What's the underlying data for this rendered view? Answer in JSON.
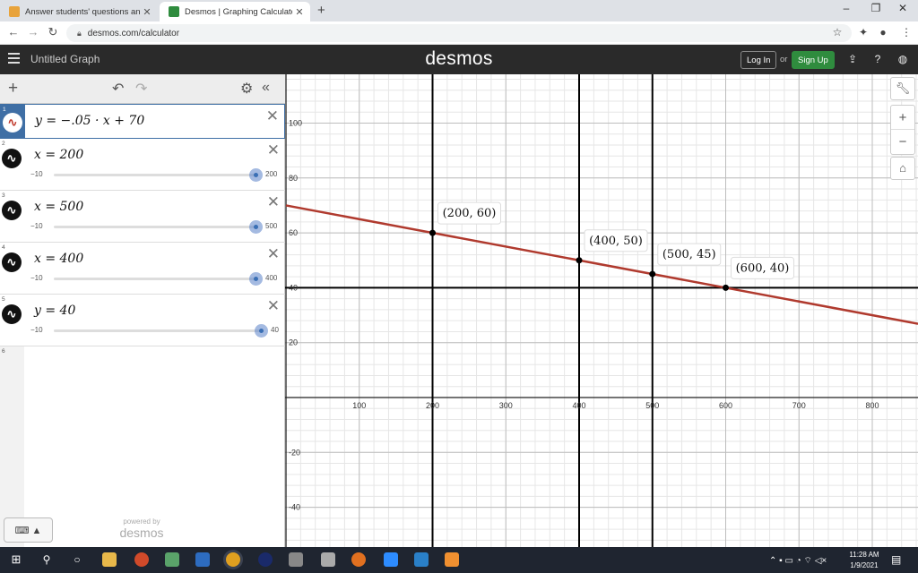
{
  "browser": {
    "tabs": [
      {
        "title": "Answer students' questions and ",
        "active": false
      },
      {
        "title": "Desmos | Graphing Calculator",
        "active": true
      }
    ],
    "url": "desmos.com/calculator"
  },
  "header": {
    "graph_title": "Untitled Graph",
    "brand": "desmos",
    "login_label": "Log In",
    "or_label": "or",
    "signup_label": "Sign Up"
  },
  "expressions": [
    {
      "index": "1",
      "latex": "y = −.05 · x + 70"
    },
    {
      "index": "2",
      "latex": "x = 200",
      "slider": {
        "min": "−10",
        "max": "200",
        "fraction": 1.0
      }
    },
    {
      "index": "3",
      "latex": "x = 500",
      "slider": {
        "min": "−10",
        "max": "500",
        "fraction": 1.0
      }
    },
    {
      "index": "4",
      "latex": "x = 400",
      "slider": {
        "min": "−10",
        "max": "400",
        "fraction": 1.0
      }
    },
    {
      "index": "5",
      "latex": "y = 40",
      "slider": {
        "min": "−10",
        "max": "40",
        "fraction": 1.0
      }
    },
    {
      "index": "6",
      "latex": ""
    }
  ],
  "powered_by": "powered by",
  "powered_brand": "desmos",
  "graph": {
    "x_ticks": [
      "100",
      "200",
      "300",
      "400",
      "500",
      "600",
      "700",
      "800"
    ],
    "y_ticks": [
      "100",
      "80",
      "60",
      "40",
      "20",
      "-20",
      "-40"
    ],
    "line_color": "#b03a2e",
    "points": [
      {
        "label": "(200, 60)",
        "x": 200,
        "y": 60
      },
      {
        "label": "(400, 50)",
        "x": 400,
        "y": 50
      },
      {
        "label": "(500, 45)",
        "x": 500,
        "y": 45
      },
      {
        "label": "(600, 40)",
        "x": 600,
        "y": 40
      }
    ]
  },
  "taskbar": {
    "time": "11:28 AM",
    "date": "1/9/2021"
  }
}
